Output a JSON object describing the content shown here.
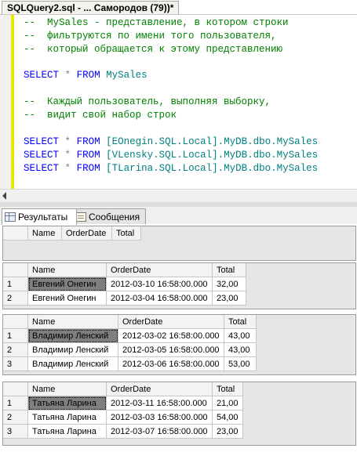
{
  "doc_tab": {
    "title": "SQLQuery2.sql - ... Самородов (79))*"
  },
  "editor": {
    "comment1": {
      "l1": "--  MySales - представление, в котором строки",
      "l2": "--  фильтруются по имени того пользователя,",
      "l3": "--  который обращается к этому представлению"
    },
    "q0": {
      "kw1": "SELECT",
      "star": "*",
      "kw2": "FROM",
      "obj": "MySales"
    },
    "comment2": {
      "l1": "--  Каждый пользователь, выполняя выборку,",
      "l2": "--  видит свой набор строк"
    },
    "q1": {
      "kw1": "SELECT",
      "star": "*",
      "kw2": "FROM",
      "obj": "[EOnegin.SQL.Local].MyDB.dbo.MySales"
    },
    "q2": {
      "kw1": "SELECT",
      "star": "*",
      "kw2": "FROM",
      "obj": "[VLensky.SQL.Local].MyDB.dbo.MySales"
    },
    "q3": {
      "kw1": "SELECT",
      "star": "*",
      "kw2": "FROM",
      "obj": "[TLarina.SQL.Local].MyDB.dbo.MySales"
    }
  },
  "result_tabs": {
    "results": "Результаты",
    "messages": "Сообщения"
  },
  "grids": {
    "g0": {
      "headers": [
        "Name",
        "OrderDate",
        "Total"
      ]
    },
    "g1": {
      "headers": [
        "Name",
        "OrderDate",
        "Total"
      ],
      "rows": [
        [
          "1",
          "Евгений Онегин",
          "2012-03-10 16:58:00.000",
          "32,00"
        ],
        [
          "2",
          "Евгений Онегин",
          "2012-03-04 16:58:00.000",
          "23,00"
        ]
      ]
    },
    "g2": {
      "headers": [
        "Name",
        "OrderDate",
        "Total"
      ],
      "rows": [
        [
          "1",
          "Владимир Ленский",
          "2012-03-02 16:58:00.000",
          "43,00"
        ],
        [
          "2",
          "Владимир Ленский",
          "2012-03-05 16:58:00.000",
          "43,00"
        ],
        [
          "3",
          "Владимир Ленский",
          "2012-03-06 16:58:00.000",
          "53,00"
        ]
      ]
    },
    "g3": {
      "headers": [
        "Name",
        "OrderDate",
        "Total"
      ],
      "rows": [
        [
          "1",
          "Татьяна Ларина",
          "2012-03-11 16:58:00.000",
          "21,00"
        ],
        [
          "2",
          "Татьяна Ларина",
          "2012-03-03 16:58:00.000",
          "54,00"
        ],
        [
          "3",
          "Татьяна Ларина",
          "2012-03-07 16:58:00.000",
          "23,00"
        ]
      ]
    }
  }
}
